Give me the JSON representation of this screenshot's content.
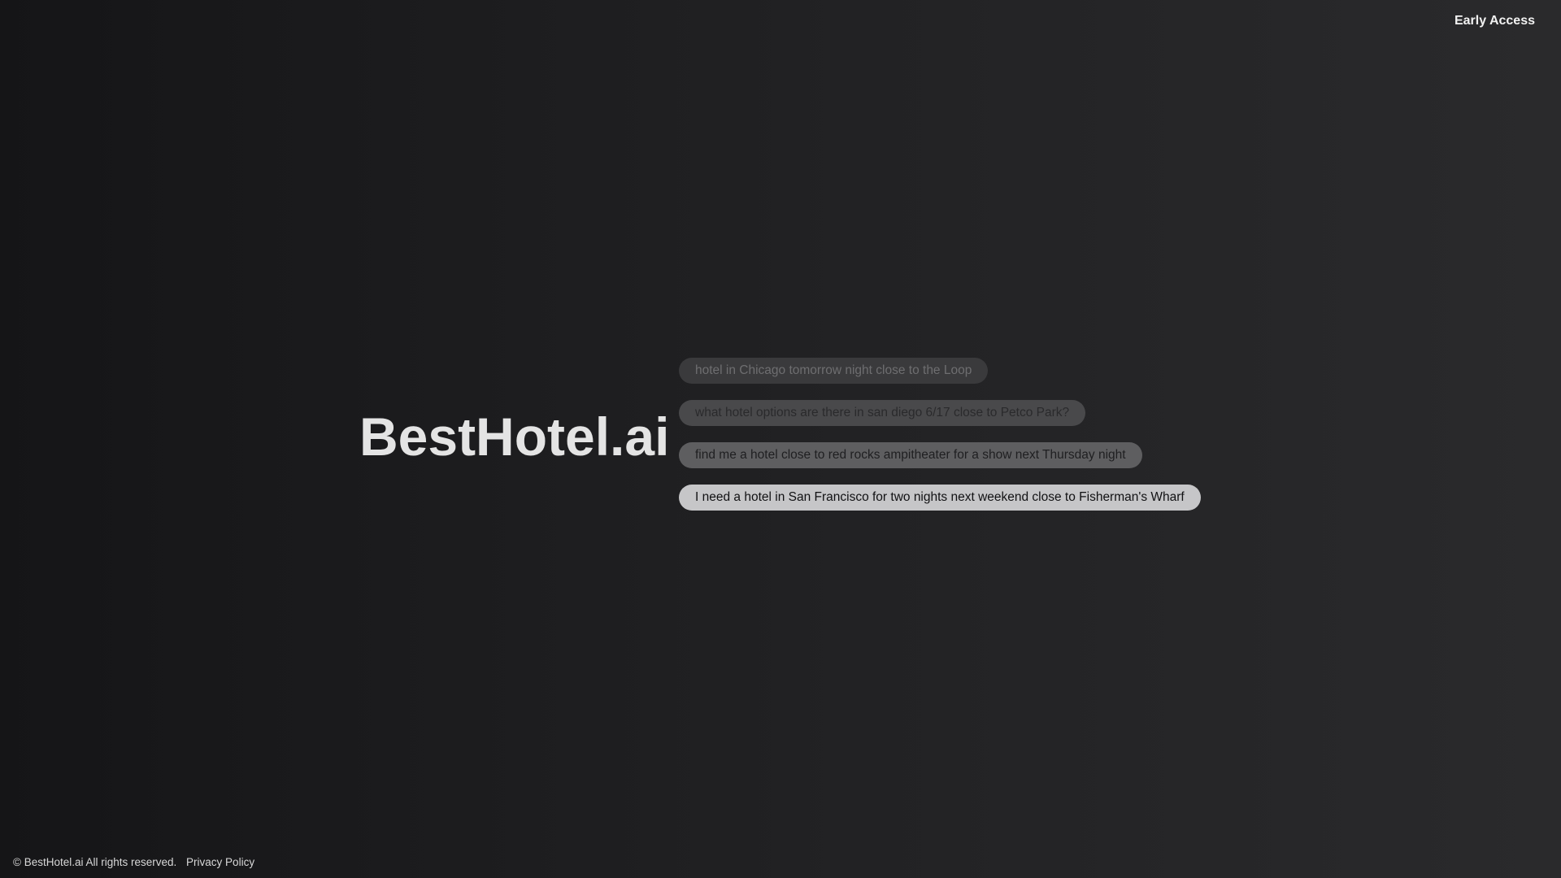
{
  "header": {
    "early_access_label": "Early Access"
  },
  "hero": {
    "brand_title": "BestHotel.ai"
  },
  "suggestions": [
    {
      "text": "hotel in Chicago tomorrow night close to the Loop"
    },
    {
      "text": "what hotel options are there in san diego 6/17 close to Petco Park?"
    },
    {
      "text": "find me a hotel close to red rocks ampitheater for a show next Thursday night"
    },
    {
      "text": "I need a hotel in San Francisco for two nights next weekend close to Fisherman's Wharf"
    }
  ],
  "footer": {
    "copyright": "© BestHotel.ai All rights reserved.",
    "privacy_label": "Privacy Policy"
  },
  "colors": {
    "background_left": "#151517",
    "background_right": "#2a2a2c",
    "brand_text": "#e4e4e4",
    "active_pill": "#c6c6c8"
  }
}
